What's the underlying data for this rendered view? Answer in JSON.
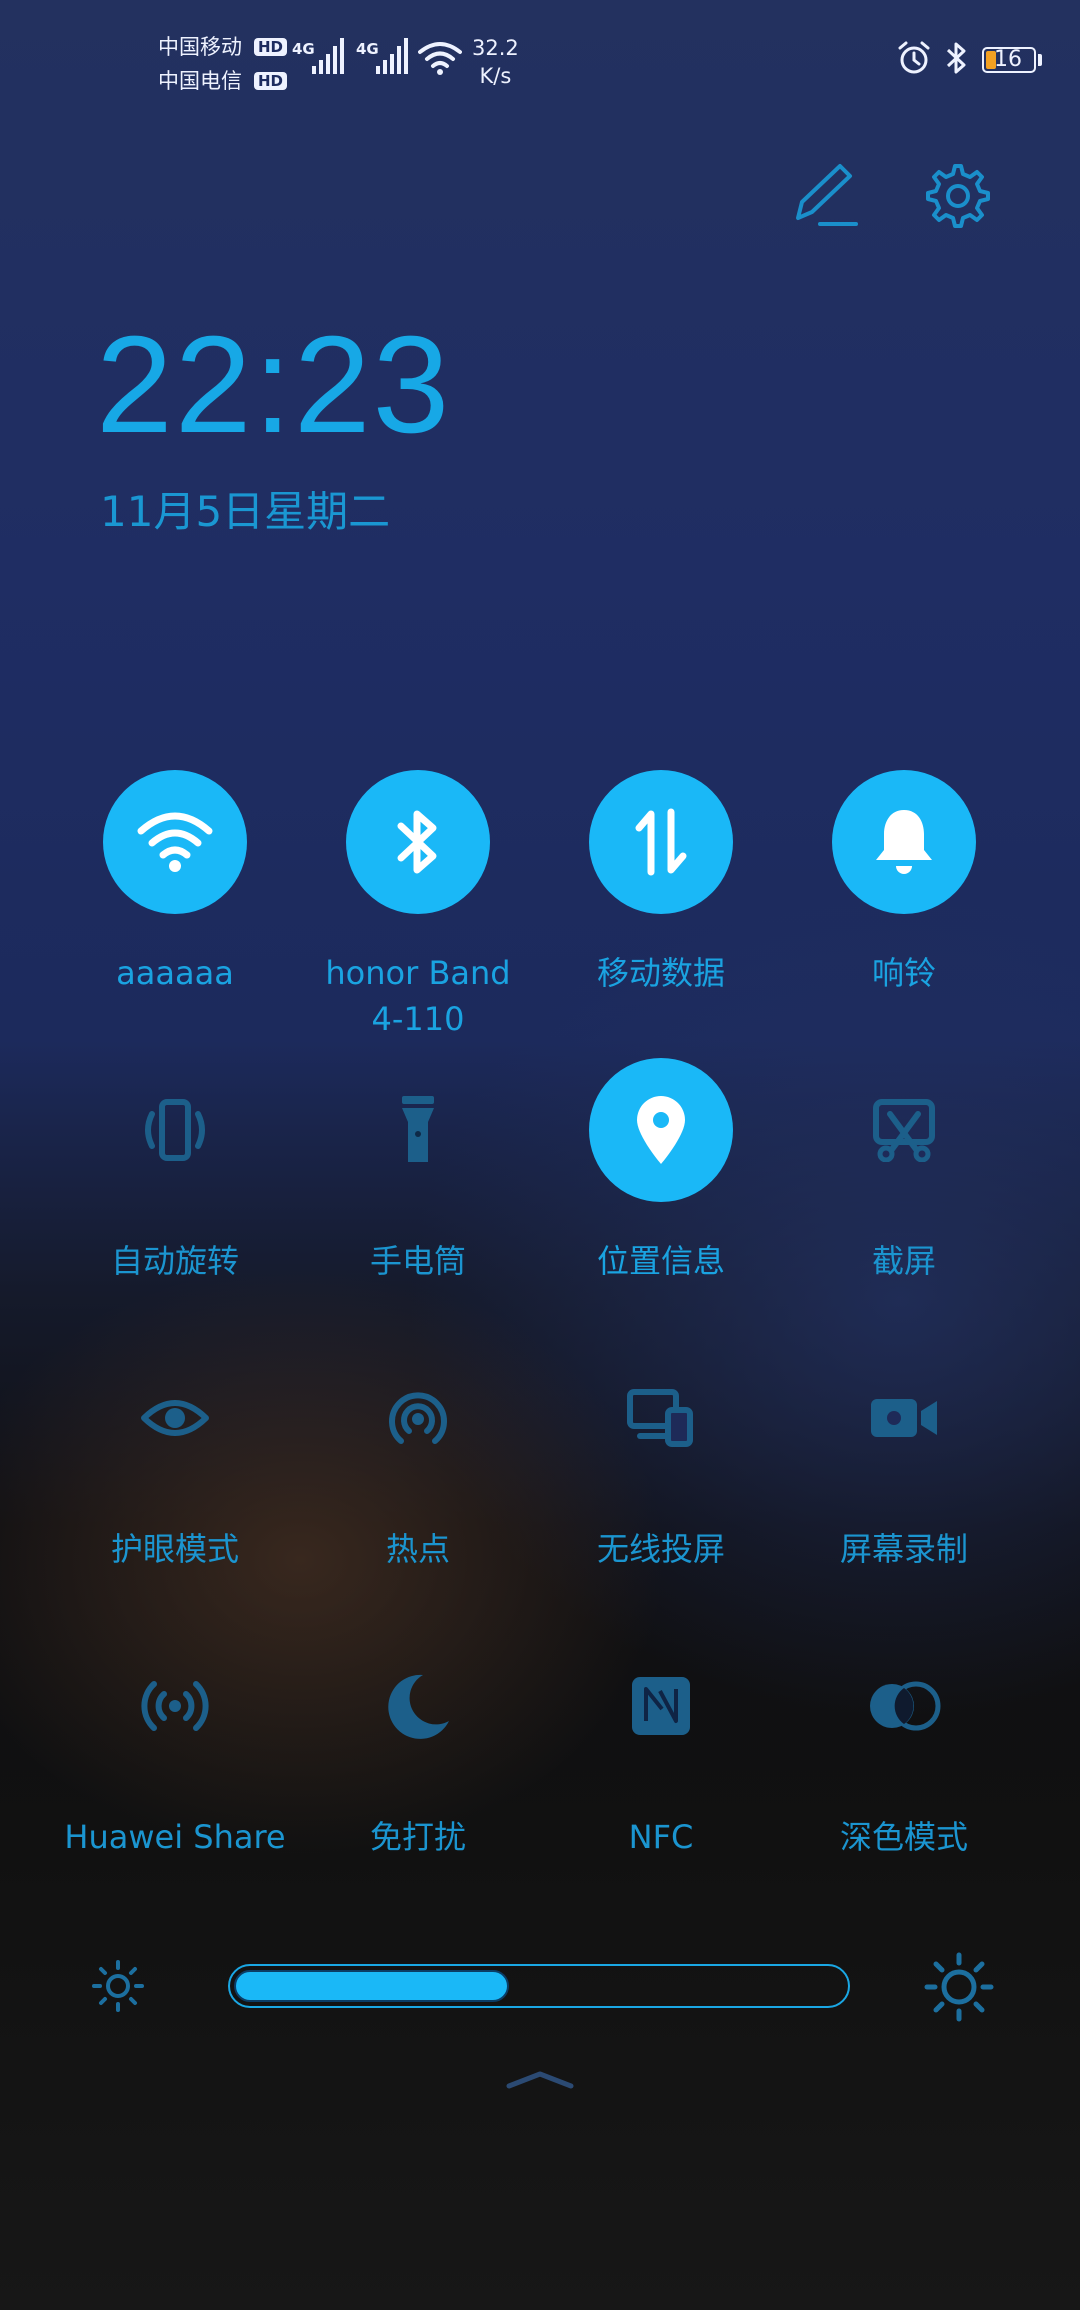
{
  "status_bar": {
    "carrier1": "中国移动",
    "carrier2": "中国电信",
    "hd": "HD",
    "net1": "4G",
    "net2": "4G",
    "speed_value": "32.2",
    "speed_unit": "K/s",
    "battery_level": "16",
    "icons": [
      "alarm-icon",
      "bluetooth-icon",
      "battery-icon"
    ]
  },
  "header": {
    "edit_icon": "pencil-icon",
    "settings_icon": "gear-icon"
  },
  "clock": {
    "time": "22:23",
    "date": "11月5日星期二"
  },
  "tiles": [
    {
      "label": "aaaaaa",
      "icon": "wifi-icon",
      "active": true
    },
    {
      "label": "honor Band 4-110",
      "icon": "bluetooth-icon",
      "active": true
    },
    {
      "label": "移动数据",
      "icon": "mobile-data-icon",
      "active": true
    },
    {
      "label": "响铃",
      "icon": "bell-icon",
      "active": true
    },
    {
      "label": "自动旋转",
      "icon": "auto-rotate-icon",
      "active": false
    },
    {
      "label": "手电筒",
      "icon": "flashlight-icon",
      "active": false
    },
    {
      "label": "位置信息",
      "icon": "location-icon",
      "active": true
    },
    {
      "label": "截屏",
      "icon": "screenshot-icon",
      "active": false
    },
    {
      "label": "护眼模式",
      "icon": "eye-icon",
      "active": false
    },
    {
      "label": "热点",
      "icon": "hotspot-icon",
      "active": false
    },
    {
      "label": "无线投屏",
      "icon": "cast-icon",
      "active": false
    },
    {
      "label": "屏幕录制",
      "icon": "video-record-icon",
      "active": false
    },
    {
      "label": "Huawei Share",
      "icon": "huawei-share-icon",
      "active": false
    },
    {
      "label": "免打扰",
      "icon": "moon-icon",
      "active": false
    },
    {
      "label": "NFC",
      "icon": "nfc-icon",
      "active": false
    },
    {
      "label": "深色模式",
      "icon": "dark-mode-icon",
      "active": false
    }
  ],
  "brightness": {
    "level": 0.45,
    "low_icon": "sun-small-icon",
    "high_icon": "sun-large-icon"
  },
  "colors": {
    "accent": "#1ab8f7",
    "inactive_icon": "#1c5f8a"
  }
}
